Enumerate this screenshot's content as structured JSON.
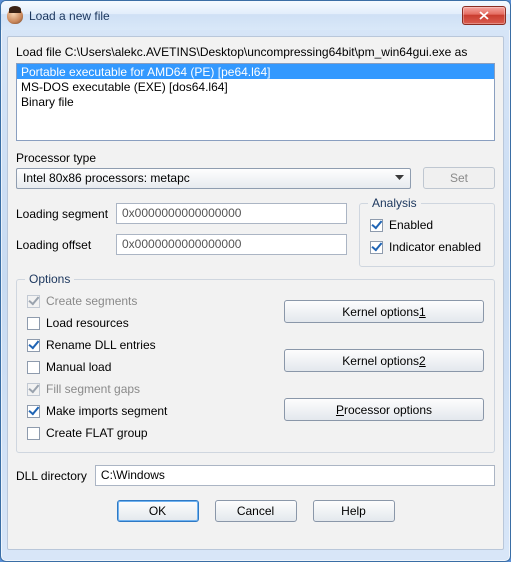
{
  "window": {
    "title": "Load a new file"
  },
  "load_line": "Load file C:\\Users\\alekc.AVETINS\\Desktop\\uncompressing64bit\\pm_win64gui.exe as",
  "file_types": [
    "Portable executable for AMD64 (PE) [pe64.l64]",
    "MS-DOS executable (EXE) [dos64.l64]",
    "Binary file"
  ],
  "processor": {
    "label": "Processor type",
    "value": "Intel 80x86 processors: metapc",
    "set_label": "Set"
  },
  "segments": {
    "loading_segment_label": "Loading segment",
    "loading_segment_value": "0x0000000000000000",
    "loading_offset_label": "Loading offset",
    "loading_offset_value": "0x0000000000000000"
  },
  "analysis": {
    "title": "Analysis",
    "enabled_label": "Enabled",
    "indicator_label": "Indicator enabled"
  },
  "options": {
    "title": "Options",
    "create_segments": "Create segments",
    "load_resources": "Load resources",
    "rename_dll": "Rename DLL entries",
    "manual_load": "Manual load",
    "fill_gaps": "Fill segment gaps",
    "make_imports": "Make imports segment",
    "create_flat": "Create FLAT group"
  },
  "buttons": {
    "kernel1_pre": "Kernel options ",
    "kernel1_u": "1",
    "kernel2_pre": "Kernel options ",
    "kernel2_u": "2",
    "processor_u": "P",
    "processor_post": "rocessor options"
  },
  "dll": {
    "label": "DLL directory",
    "value": "C:\\Windows"
  },
  "footer": {
    "ok": "OK",
    "cancel": "Cancel",
    "help": "Help"
  }
}
